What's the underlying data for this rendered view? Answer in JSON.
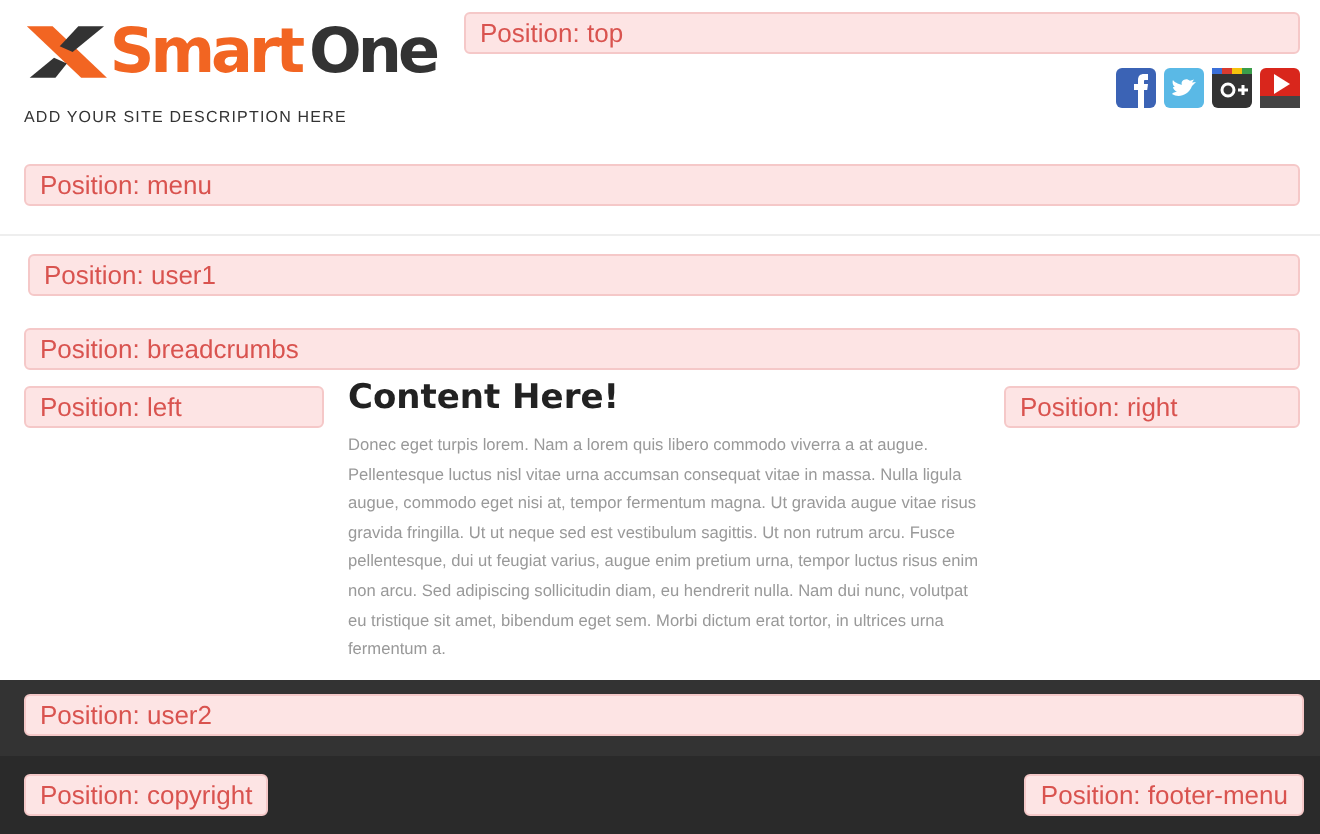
{
  "logo": {
    "first_word": "Smart",
    "second_word": "One",
    "tagline": "ADD YOUR SITE DESCRIPTION HERE"
  },
  "positions": {
    "top": "Position: top",
    "menu": "Position: menu",
    "user1": "Position: user1",
    "breadcrumbs": "Position: breadcrumbs",
    "left": "Position: left",
    "right": "Position: right",
    "user2": "Position: user2",
    "copyright": "Position: copyright",
    "footer_menu": "Position: footer-menu"
  },
  "social_icons": [
    {
      "kind": "facebook"
    },
    {
      "kind": "twitter"
    },
    {
      "kind": "googleplus"
    },
    {
      "kind": "youtube"
    }
  ],
  "content": {
    "title": "Content Here!",
    "body": "Donec eget turpis lorem. Nam a lorem quis libero commodo viverra a at augue. Pellentesque luctus nisl vitae urna accumsan consequat vitae in massa. Nulla ligula augue, commodo eget nisi at, tempor fermentum magna. Ut gravida augue vitae risus gravida fringilla. Ut ut neque sed est vestibulum sagittis. Ut non rutrum arcu. Fusce pellentesque, dui ut feugiat varius, augue enim pretium urna, tempor luctus risus enim non arcu. Sed adipiscing sollicitudin diam, eu hendrerit nulla. Nam dui nunc, volutpat eu tristique sit amet, bibendum eget sem. Morbi dictum erat tortor, in ultrices urna fermentum a."
  }
}
